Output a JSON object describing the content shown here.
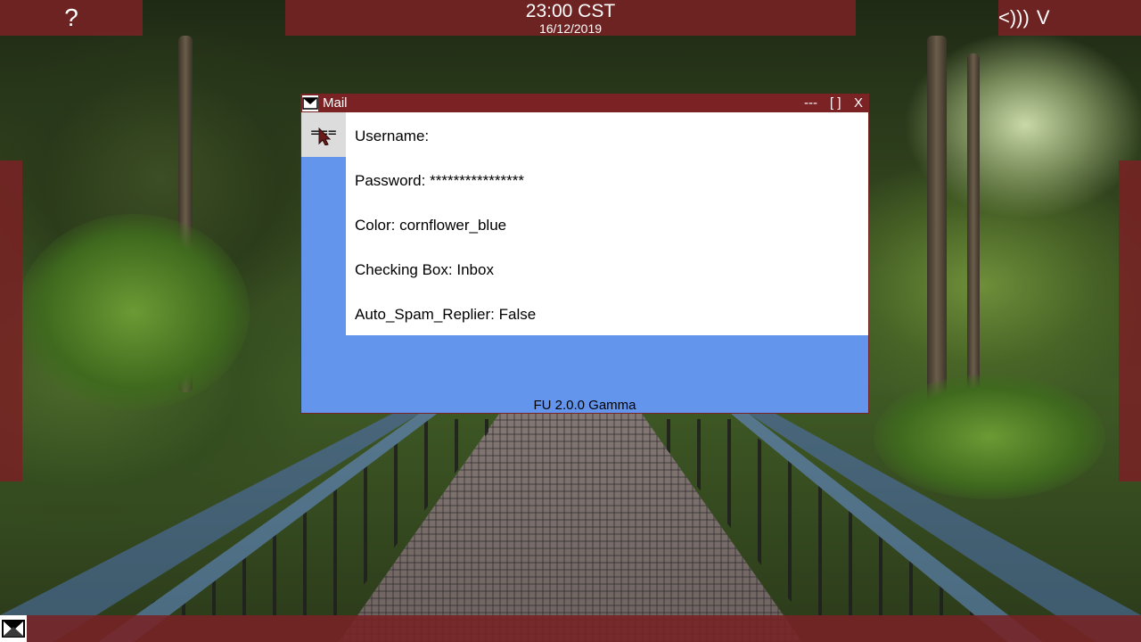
{
  "topbar": {
    "help_label": "?",
    "clock_time": "23:00 CST",
    "clock_date": "16/12/2019",
    "volume_icon": "<)))",
    "network_icon": "V"
  },
  "mail_window": {
    "title": "Mail",
    "controls": {
      "minimize": "---",
      "maximize": "[ ]",
      "close": "X"
    },
    "menu_toggle": "===",
    "settings": [
      {
        "label": "Username:",
        "value": ""
      },
      {
        "label": "Password:",
        "value": "****************"
      },
      {
        "label": "Color:",
        "value": "cornflower_blue"
      },
      {
        "label": "Checking Box:",
        "value": "Inbox"
      },
      {
        "label": "Auto_Spam_Replier:",
        "value": "False"
      }
    ],
    "version": "FU 2.0.0 Gamma"
  },
  "colors": {
    "panel": "#7a2224",
    "accent": "#6495ed",
    "content_bg": "#ffffff"
  },
  "icons": {
    "mail_icon": "envelope-icon",
    "start_icon": "envelope-icon",
    "cursor": "pointer-cursor-icon"
  }
}
